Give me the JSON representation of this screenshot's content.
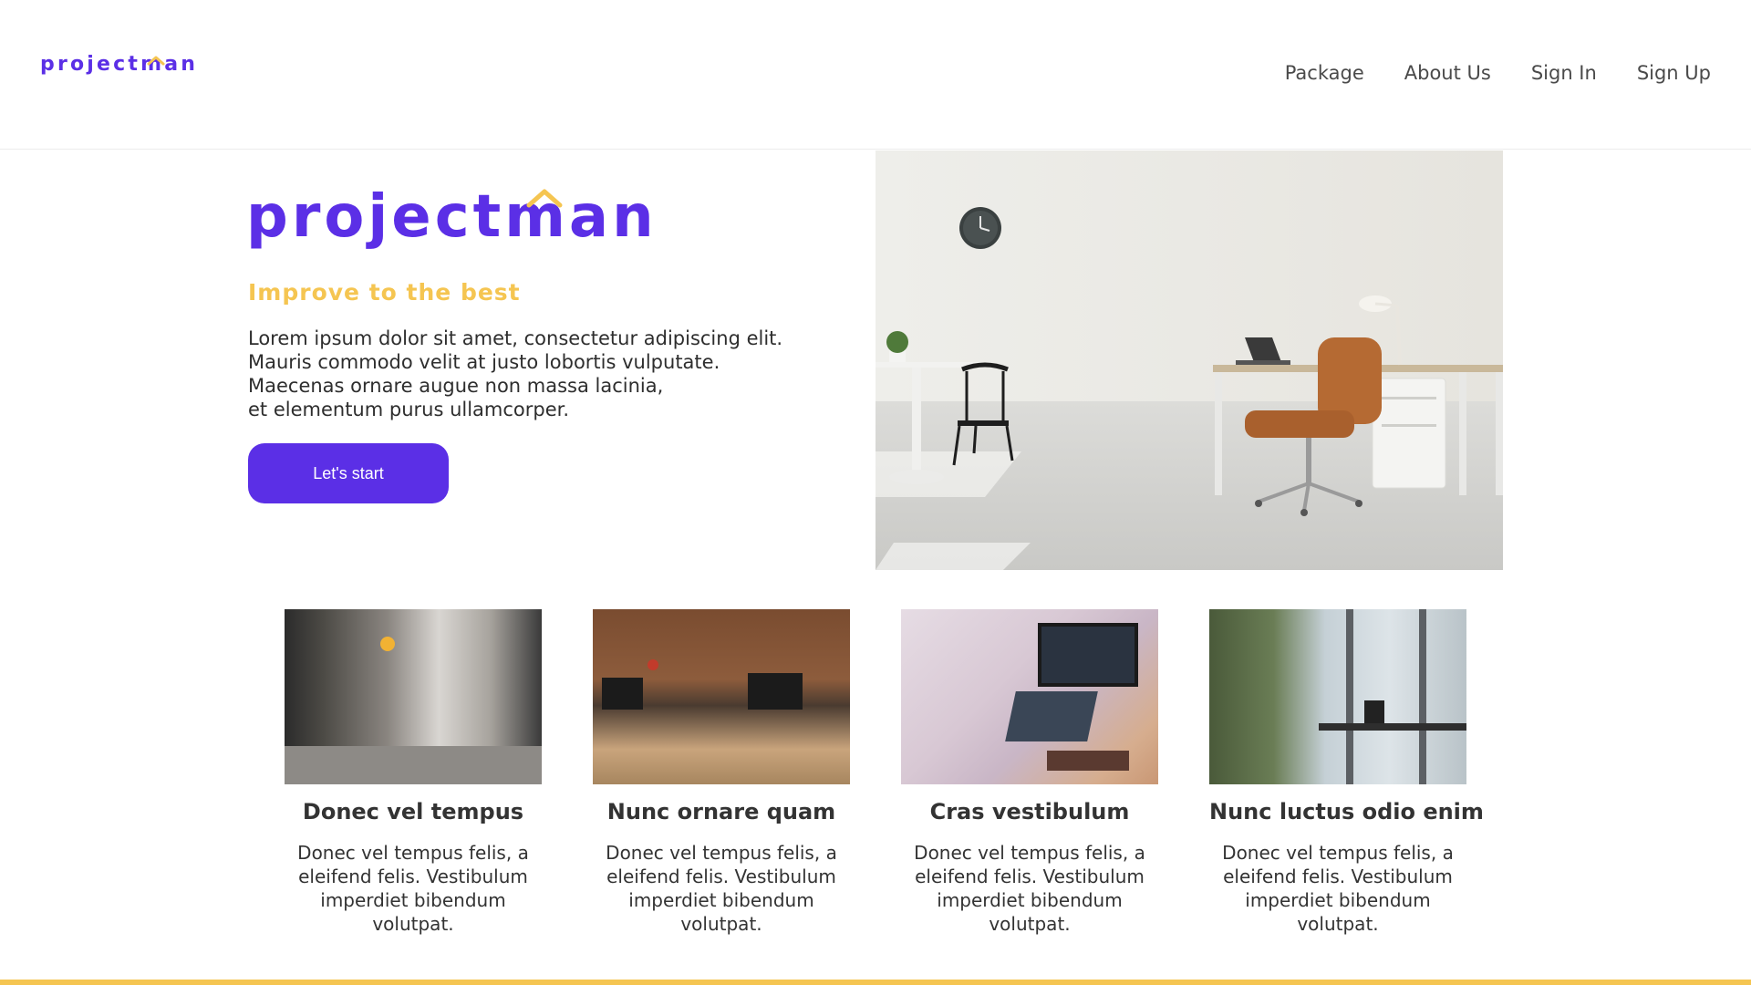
{
  "brand": {
    "name": "projectman",
    "accent": "#5b2fe6",
    "secondary": "#f5c551"
  },
  "nav": {
    "items": [
      {
        "label": "Package"
      },
      {
        "label": "About Us"
      },
      {
        "label": "Sign In"
      },
      {
        "label": "Sign Up"
      }
    ]
  },
  "hero": {
    "title": "projectman",
    "tagline": "Improve to the best",
    "lines": [
      "Lorem ipsum dolor sit amet, consectetur adipiscing elit.",
      "Mauris commodo velit at justo lobortis vulputate.",
      "Maecenas ornare augue non massa lacinia,",
      "et elementum purus ullamcorper."
    ],
    "cta_label": "Let's start"
  },
  "cards": [
    {
      "title": "Donec vel tempus",
      "desc": "Donec vel tempus felis, a eleifend felis. Vestibulum imperdiet bibendum volutpat."
    },
    {
      "title": "Nunc ornare quam",
      "desc": "Donec vel tempus felis, a eleifend felis. Vestibulum imperdiet bibendum volutpat."
    },
    {
      "title": "Cras vestibulum",
      "desc": "Donec vel tempus felis, a eleifend felis. Vestibulum imperdiet bibendum volutpat."
    },
    {
      "title": "Nunc luctus odio enim",
      "desc": "Donec vel tempus felis, a eleifend felis. Vestibulum imperdiet bibendum volutpat."
    }
  ]
}
